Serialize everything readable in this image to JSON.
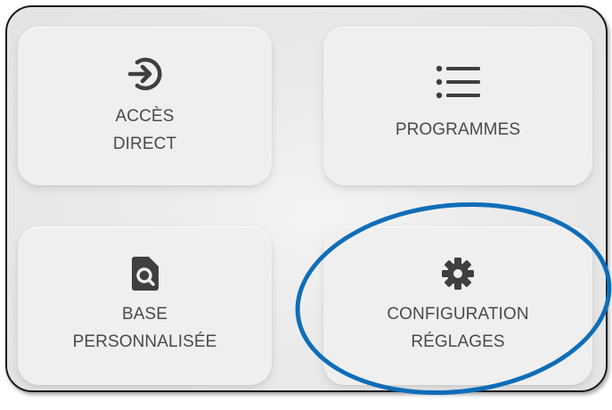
{
  "tiles": [
    {
      "id": "acces-direct",
      "line1": "ACCÈS",
      "line2": "DIRECT",
      "icon": "login-arrow-icon"
    },
    {
      "id": "programmes",
      "line1": "PROGRAMMES",
      "line2": "",
      "icon": "list-icon"
    },
    {
      "id": "base-personnalisee",
      "line1": "BASE",
      "line2": "PERSONNALISÉE",
      "icon": "search-document-icon"
    },
    {
      "id": "configuration-reglages",
      "line1": "CONFIGURATION",
      "line2": "RÉGLAGES",
      "icon": "gear-icon"
    }
  ],
  "colors": {
    "label": "#4a4a4a",
    "icon": "#3f3f3f",
    "highlight_ring": "#0f6db8",
    "tile_bg": "#efefef"
  }
}
